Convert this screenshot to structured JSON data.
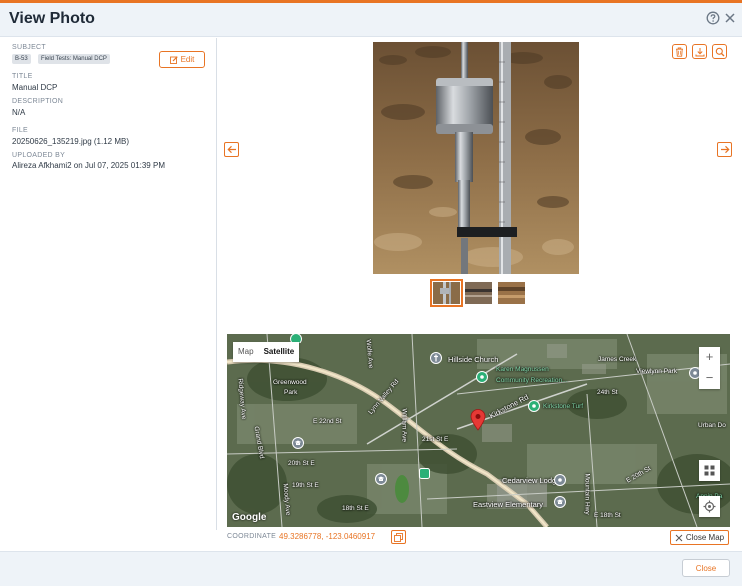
{
  "dialog": {
    "title": "View Photo"
  },
  "sidebar": {
    "subject_label": "SUBJECT",
    "subject_tags": [
      "B-53",
      "Field Tests: Manual DCP"
    ],
    "edit_label": "Edit",
    "title_label": "TITLE",
    "title_value": "Manual DCP",
    "description_label": "DESCRIPTION",
    "description_value": "N/A",
    "file_label": "FILE",
    "file_value": "20250626_135219.jpg (1.12 MB)",
    "uploaded_label": "UPLOADED BY",
    "uploaded_value": "Alireza Afkhami2 on Jul 07, 2025 01:39 PM"
  },
  "viewer": {
    "thumbnail_count": 3,
    "selected_thumbnail": 1
  },
  "map": {
    "map_tab": "Map",
    "satellite_tab": "Satellite",
    "active_tab": "Satellite",
    "zoom_in": "+",
    "zoom_out": "−",
    "attribution": "Google",
    "labels": {
      "hillside_church": "Hillside Church",
      "karen_magnussen": "Karen Magnussen",
      "community_rec": "Community Recreation...",
      "james_creek": "James Creek",
      "viewlynn_park": "Viewlynn Park",
      "st_24th": "24th St",
      "greenwood": "Greenwood",
      "park": "Park",
      "lynn_valley_rd": "Lynn Valley Rd",
      "william_ave": "William Ave",
      "kirkstone_rd": "Kirkstone Rd",
      "kirkstone_turf": "Kirkstone Turf",
      "e_22nd": "E 22nd St",
      "st_21st": "21st St E",
      "grand_blvd": "Grand Blvd",
      "st_20th": "20th St E",
      "st_19th": "19th St E",
      "st_18th": "18th St E",
      "cedarview_lodge": "Cedarview Lodge",
      "eastview_elementary": "Eastview Elementary",
      "e_20th": "E 20th St",
      "urban": "Urban Do",
      "appin": "Appin Pa",
      "mountain_hwy": "Mountain Hwy",
      "moody_ave": "Moody Ave",
      "ridgeway_ave": "Ridgeway Ave",
      "wolfe_ave": "Wolfe Ave",
      "e_18th": "E 18th St"
    }
  },
  "coordinate": {
    "label": "COORDINATE",
    "value": "49.3286778, -123.0460917"
  },
  "close_map_label": "Close Map",
  "footer": {
    "close_label": "Close"
  },
  "colors": {
    "accent": "#e87424",
    "header_bg": "#eef3f8"
  }
}
